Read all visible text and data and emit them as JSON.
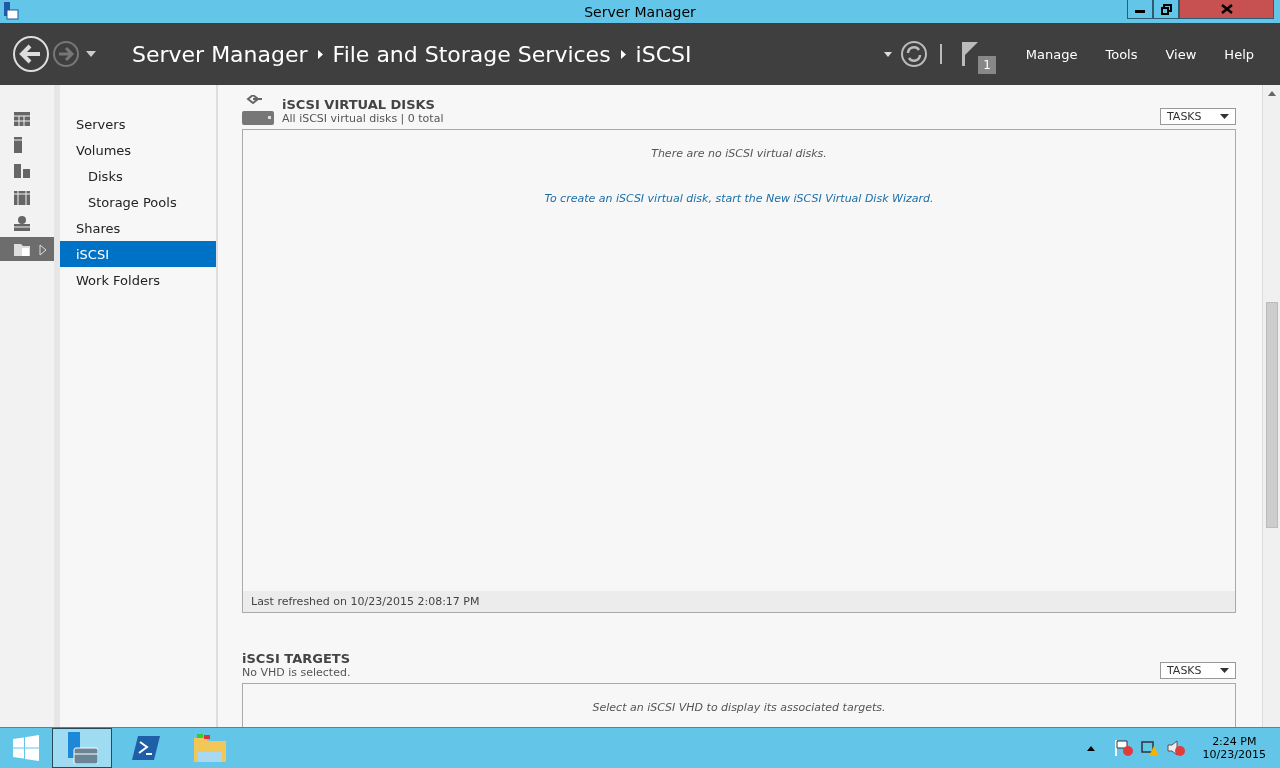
{
  "window": {
    "title": "Server Manager"
  },
  "header": {
    "breadcrumbs": [
      "Server Manager",
      "File and Storage Services",
      "iSCSI"
    ],
    "notification_count": "1",
    "menu": [
      "Manage",
      "Tools",
      "View",
      "Help"
    ]
  },
  "rail": [
    {
      "kind": "dashboard",
      "selected": false
    },
    {
      "kind": "server",
      "selected": false
    },
    {
      "kind": "servers",
      "selected": false
    },
    {
      "kind": "group",
      "selected": false
    },
    {
      "kind": "role",
      "selected": false
    },
    {
      "kind": "files",
      "selected": true
    }
  ],
  "nav": [
    {
      "label": "Servers",
      "selected": false
    },
    {
      "label": "Volumes",
      "selected": false,
      "children": [
        {
          "label": "Disks",
          "selected": false
        },
        {
          "label": "Storage Pools",
          "selected": false
        }
      ]
    },
    {
      "label": "Shares",
      "selected": false
    },
    {
      "label": "iSCSI",
      "selected": true
    },
    {
      "label": "Work Folders",
      "selected": false
    }
  ],
  "sections": [
    {
      "title": "iSCSI VIRTUAL DISKS",
      "subtitle": "All iSCSI virtual disks | 0 total",
      "tasks": "TASKS",
      "icon": true,
      "messages": [
        {
          "kind": "note",
          "text": "There are no iSCSI virtual disks."
        },
        {
          "kind": "link",
          "text": "To create an iSCSI virtual disk, start the New iSCSI Virtual Disk Wizard."
        }
      ],
      "footer": "Last refreshed on 10/23/2015 2:08:17 PM"
    },
    {
      "title": "iSCSI TARGETS",
      "subtitle": "No VHD is selected.",
      "tasks": "TASKS",
      "icon": false,
      "messages": [
        {
          "kind": "note",
          "text": "Select an iSCSI VHD to display its associated targets."
        }
      ]
    }
  ],
  "taskbar": {
    "apps": [
      {
        "kind": "server-manager",
        "selected": true
      },
      {
        "kind": "powershell",
        "selected": false
      },
      {
        "kind": "explorer",
        "selected": false
      }
    ],
    "time": "2:24 PM",
    "date": "10/23/2015"
  }
}
